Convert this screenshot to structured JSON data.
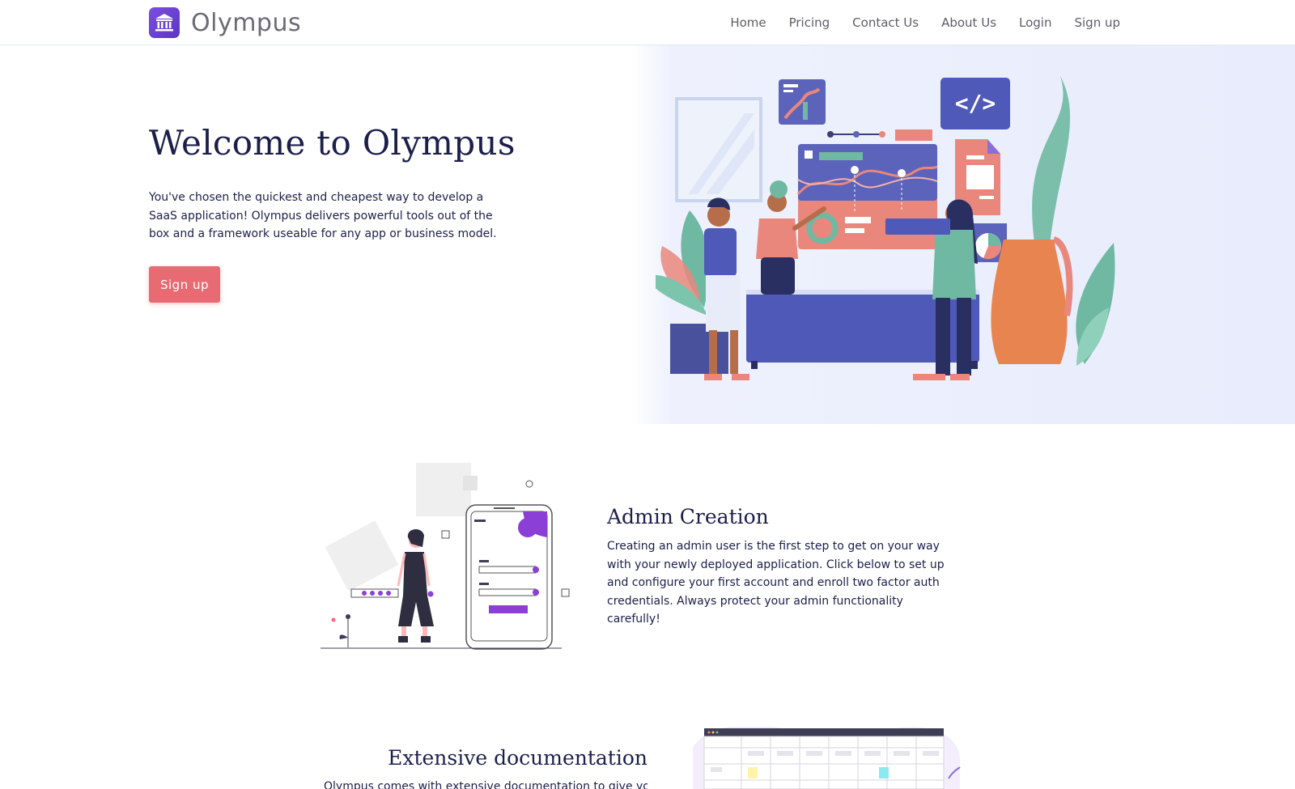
{
  "nav": {
    "brand": "Olympus",
    "links": [
      "Home",
      "Pricing",
      "Contact Us",
      "About Us",
      "Login",
      "Sign up"
    ]
  },
  "hero": {
    "title": "Welcome to Olympus",
    "text": "You've chosen the quickest and cheapest way to develop a SaaS application! Olympus delivers powerful tools out of the box and a framework useable for any app or business model.",
    "button": "Sign up",
    "code_badge": "</>"
  },
  "features": [
    {
      "title": "Admin Creation",
      "text": "Creating an admin user is the first step to get on your way with your newly deployed application. Click below to set up and configure your first account and enroll two factor auth credentials. Always protect your admin functionality carefully!"
    },
    {
      "title": "Extensive documentation",
      "text": "Olympus comes with extensive documentation to give you"
    }
  ],
  "colors": {
    "primary_button": "#e86b74",
    "brand_logo": "#6a42d4",
    "heading": "#1b1f4a",
    "hero_background": "#e8ecfc"
  },
  "icons": {
    "brand_logo": "bank-columns-icon"
  }
}
